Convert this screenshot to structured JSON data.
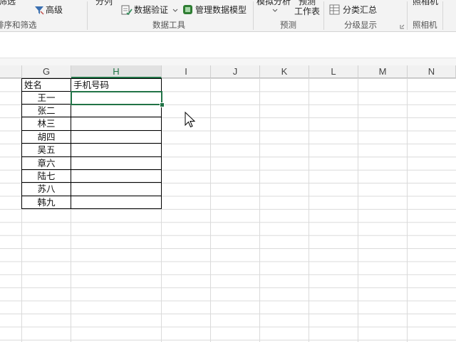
{
  "ribbon": {
    "sort_filter_group": {
      "filter_label": "筛选",
      "advanced_label": "高级",
      "group_label": "排序和筛选"
    },
    "data_tools_group": {
      "split_label": "分列",
      "validation_label": "数据验证",
      "manage_model_label": "管理数据模型",
      "group_label": "数据工具"
    },
    "forecast_group": {
      "whatif_label": "模拟分析",
      "forecast_label": "预测",
      "sheet_label": "工作表",
      "group_label": "预测"
    },
    "outline_group": {
      "subtotal_label": "分类汇总",
      "group_label": "分级显示"
    },
    "camera_group": {
      "camera_label": "照相机",
      "group_label": "照相机"
    }
  },
  "columns": [
    "G",
    "H",
    "I",
    "J",
    "K",
    "L",
    "M",
    "N"
  ],
  "selected_column": "H",
  "table": {
    "header": {
      "name": "姓名",
      "phone": "手机号码"
    },
    "names": [
      "王一",
      "张二",
      "林三",
      "胡四",
      "吴五",
      "章六",
      "陆七",
      "苏八",
      "韩九"
    ]
  },
  "colors": {
    "accent": "#217346"
  }
}
